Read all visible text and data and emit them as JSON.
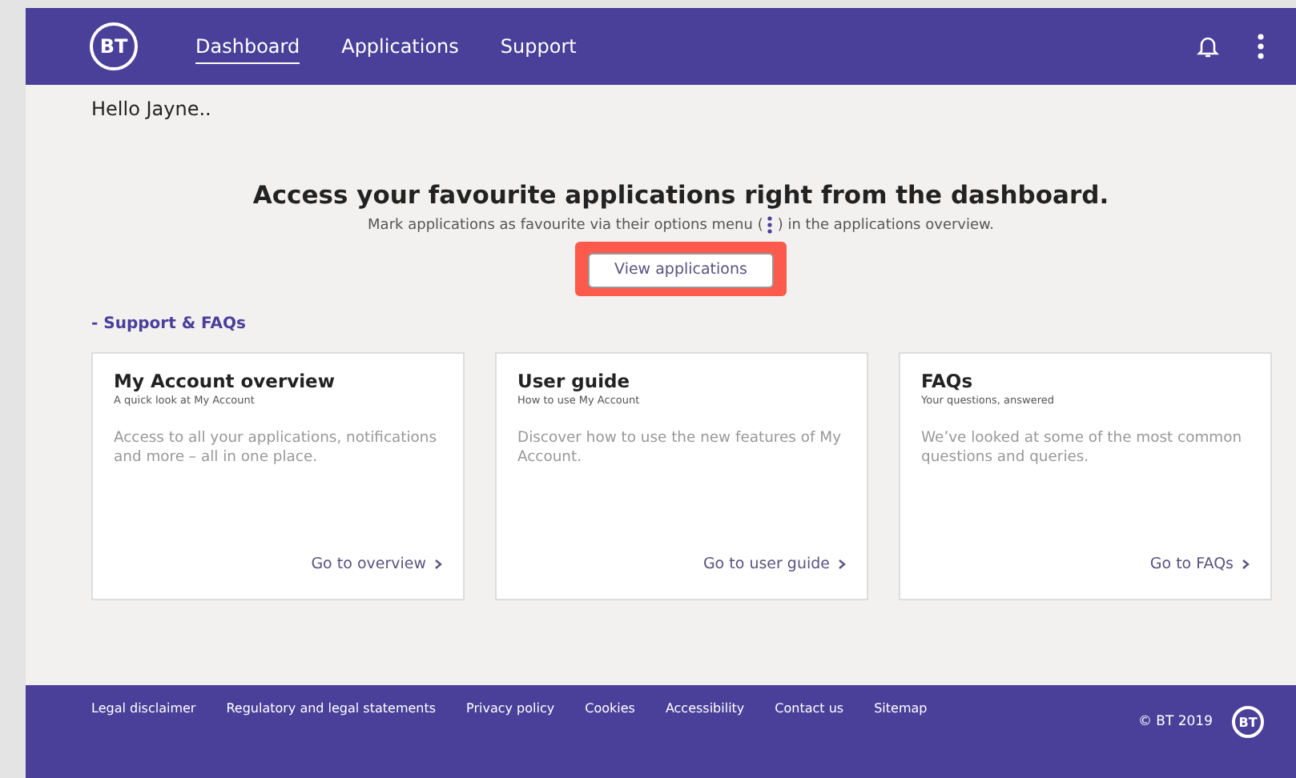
{
  "header": {
    "logo": "BT",
    "nav": [
      {
        "label": "Dashboard",
        "selected": true
      },
      {
        "label": "Applications",
        "selected": false
      },
      {
        "label": "Support",
        "selected": false
      }
    ]
  },
  "greeting": "Hello Jayne..",
  "hero": {
    "title": "Access your favourite applications right from the dashboard.",
    "subtitle_before": "Mark applications as favourite via their options menu (",
    "subtitle_after": ") in the applications overview.",
    "button": "View applications",
    "highlighted": true
  },
  "section_title": "- Support & FAQs",
  "cards": [
    {
      "title": "My Account overview",
      "subtitle": "A quick look at My Account",
      "body": "Access to all your applications, notifications and more – all in one place.",
      "link": "Go to overview"
    },
    {
      "title": "User guide",
      "subtitle": "How to use My Account",
      "body": "Discover how to use the new features of My Account.",
      "link": "Go to user guide"
    },
    {
      "title": "FAQs",
      "subtitle": "Your questions, answered",
      "body": "We’ve looked at some of the most common questions and queries.",
      "link": "Go to FAQs"
    }
  ],
  "footer": {
    "links": [
      "Legal disclaimer",
      "Regulatory and legal statements",
      "Privacy policy",
      "Cookies",
      "Accessibility",
      "Contact us",
      "Sitemap"
    ],
    "copyright": "© BT 2019",
    "logo": "BT"
  }
}
